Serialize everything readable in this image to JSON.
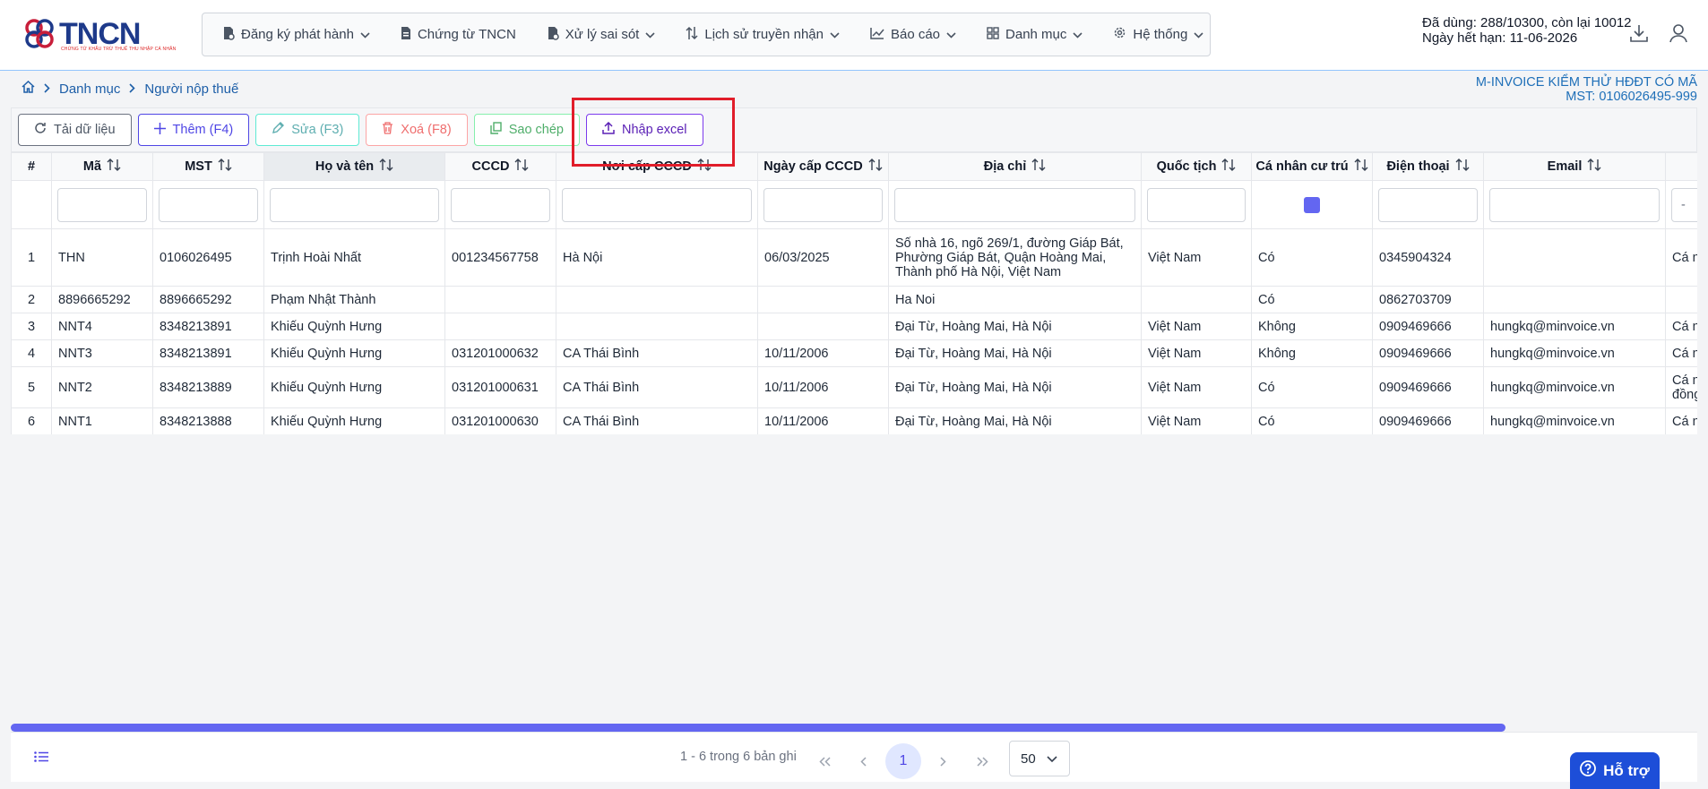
{
  "brand": {
    "name": "TNCN",
    "tagline": "CHỨNG TỪ KHẤU TRỪ THUẾ THU NHẬP CÁ NHÂN"
  },
  "nav": [
    {
      "label": "Đăng ký phát hành",
      "icon": "file-doc-icon",
      "dropdown": true
    },
    {
      "label": "Chứng từ TNCN",
      "icon": "document-icon",
      "dropdown": false
    },
    {
      "label": "Xử lý sai sót",
      "icon": "file-error-icon",
      "dropdown": true
    },
    {
      "label": "Lịch sử truyền nhận",
      "icon": "transfer-arrows-icon",
      "dropdown": true
    },
    {
      "label": "Báo cáo",
      "icon": "chart-line-icon",
      "dropdown": true
    },
    {
      "label": "Danh mục",
      "icon": "grid-icon",
      "dropdown": true
    },
    {
      "label": "Hệ thống",
      "icon": "gear-icon",
      "dropdown": true
    }
  ],
  "quota": {
    "used": "Đã dùng: 288/10300, còn lại 10012",
    "expiry": "Ngày hết hạn: 11-06-2026"
  },
  "breadcrumb": {
    "level1": "Danh mục",
    "level2": "Người nộp thuế"
  },
  "company": {
    "name": "M-INVOICE KIỂM THỬ HĐĐT CÓ MÃ",
    "tax": "MST: 0106026495-999"
  },
  "toolbar": {
    "reload": "Tải dữ liệu",
    "add": "Thêm (F4)",
    "edit": "Sửa (F3)",
    "delete": "Xoá (F8)",
    "copy": "Sao chép",
    "import": "Nhập excel"
  },
  "columns": [
    "#",
    "Mã",
    "MST",
    "Họ và tên",
    "CCCD",
    "Nơi cấp CCCD",
    "Ngày cấp CCCD",
    "Địa chỉ",
    "Quốc tịch",
    "Cá nhân cư trú",
    "Điện thoại",
    "Email",
    ""
  ],
  "rows": [
    [
      "1",
      "THN",
      "0106026495",
      "Trịnh Hoài Nhất",
      "001234567758",
      "Hà Nội",
      "06/03/2025",
      "Số nhà 16, ngõ 269/1, đường Giáp Bát, Phường Giáp Bát, Quận Hoàng Mai, Thành phố Hà Nội, Việt Nam",
      "Việt Nam",
      "Có",
      "0345904324",
      "",
      "Cá nh"
    ],
    [
      "2",
      "8896665292",
      "8896665292",
      "Phạm Nhật Thành",
      "",
      "",
      "",
      "Ha Noi",
      "",
      "Có",
      "0862703709",
      "",
      ""
    ],
    [
      "3",
      "NNT4",
      "8348213891",
      "Khiếu Quỳnh Hưng",
      "",
      "",
      "",
      "Đại Từ, Hoàng Mai, Hà Nội",
      "Việt Nam",
      "Không",
      "0909469666",
      "hungkq@minvoice.vn",
      "Cá nh"
    ],
    [
      "4",
      "NNT3",
      "8348213891",
      "Khiếu Quỳnh Hưng",
      "031201000632",
      "CA Thái Bình",
      "10/11/2006",
      "Đại Từ, Hoàng Mai, Hà Nội",
      "Việt Nam",
      "Không",
      "0909469666",
      "hungkq@minvoice.vn",
      "Cá nh"
    ],
    [
      "5",
      "NNT2",
      "8348213889",
      "Khiếu Quỳnh Hưng",
      "031201000631",
      "CA Thái Bình",
      "10/11/2006",
      "Đại Từ, Hoàng Mai, Hà Nội",
      "Việt Nam",
      "Có",
      "0909469666",
      "hungkq@minvoice.vn",
      "Cá nh đồng"
    ],
    [
      "6",
      "NNT1",
      "8348213888",
      "Khiếu Quỳnh Hưng",
      "031201000630",
      "CA Thái Bình",
      "10/11/2006",
      "Đại Từ, Hoàng Mai, Hà Nội",
      "Việt Nam",
      "Có",
      "0909469666",
      "hungkq@minvoice.vn",
      "Cá nh"
    ]
  ],
  "filter_select_value": "-",
  "pagination": {
    "info": "1 - 6 trong 6 bản ghi",
    "current_page": "1",
    "page_size": "50"
  },
  "help": {
    "label": "Hỗ trợ"
  },
  "colors": {
    "accent": "#4f46e5",
    "highlight": "#e11d2a",
    "link": "#1e5fa8"
  }
}
